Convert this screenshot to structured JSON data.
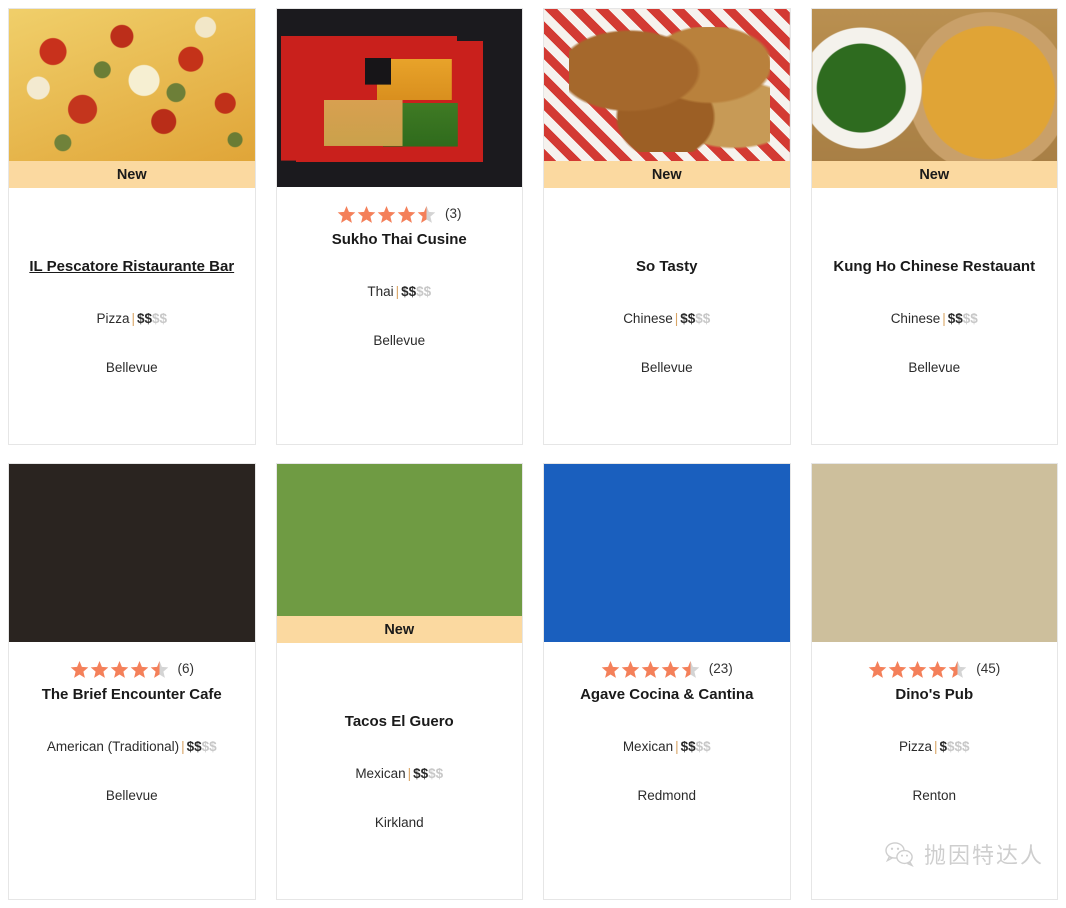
{
  "colors": {
    "star_filled": "#f4805a",
    "star_empty": "#d4d4d4",
    "new_banner_bg": "#fbd9a0",
    "card_border": "#e6e6e6",
    "price_active": "#2b2b2b",
    "price_inactive": "#c8c8c8",
    "separator": "#d9a566"
  },
  "badge": {
    "new_label": "New"
  },
  "watermark": {
    "icon": "wechat-icon",
    "text": "抛因特达人"
  },
  "cards": [
    {
      "photo": "pizza-photo",
      "badge": "New",
      "has_rating": false,
      "rating": null,
      "review_count": null,
      "name": "IL Pescatore Ristaurante Bar",
      "name_is_link": true,
      "category": "Pizza",
      "price_active": "$$",
      "price_inactive": "$$",
      "city": "Bellevue"
    },
    {
      "photo": "bento-box-photo",
      "badge": null,
      "has_rating": true,
      "rating": 4.5,
      "review_count": "(3)",
      "name": "Sukho Thai Cusine",
      "name_is_link": false,
      "category": "Thai",
      "price_active": "$$",
      "price_inactive": "$$",
      "city": "Bellevue"
    },
    {
      "photo": "fried-chicken-photo",
      "badge": "New",
      "has_rating": false,
      "rating": null,
      "review_count": null,
      "name": "So Tasty",
      "name_is_link": false,
      "category": "Chinese",
      "price_active": "$$",
      "price_inactive": "$$",
      "city": "Bellevue"
    },
    {
      "photo": "hotpot-photo",
      "badge": "New",
      "has_rating": false,
      "rating": null,
      "review_count": null,
      "name": "Kung Ho Chinese Restauant",
      "name_is_link": false,
      "category": "Chinese",
      "price_active": "$$",
      "price_inactive": "$$",
      "city": "Bellevue"
    },
    {
      "photo": "cafe-interior-photo",
      "badge": null,
      "has_rating": true,
      "rating": 4.5,
      "review_count": "(6)",
      "name": "The Brief Encounter Cafe",
      "name_is_link": false,
      "category": "American (Traditional)",
      "price_active": "$$",
      "price_inactive": "$$",
      "city": "Bellevue"
    },
    {
      "photo": "taco-stand-photo",
      "badge": "New",
      "has_rating": false,
      "rating": null,
      "review_count": null,
      "name": "Tacos El Guero",
      "name_is_link": false,
      "category": "Mexican",
      "price_active": "$$",
      "price_inactive": "$$",
      "city": "Kirkland"
    },
    {
      "photo": "agave-storefront-photo",
      "badge": null,
      "has_rating": true,
      "rating": 4.5,
      "review_count": "(23)",
      "name": "Agave Cocina & Cantina",
      "name_is_link": false,
      "category": "Mexican",
      "price_active": "$$",
      "price_inactive": "$$",
      "city": "Redmond"
    },
    {
      "photo": "dinos-pub-storefront-photo",
      "badge": null,
      "has_rating": true,
      "rating": 4.5,
      "review_count": "(45)",
      "name": "Dino's Pub",
      "name_is_link": false,
      "category": "Pizza",
      "price_active": "$",
      "price_inactive": "$$$",
      "city": "Renton"
    }
  ]
}
